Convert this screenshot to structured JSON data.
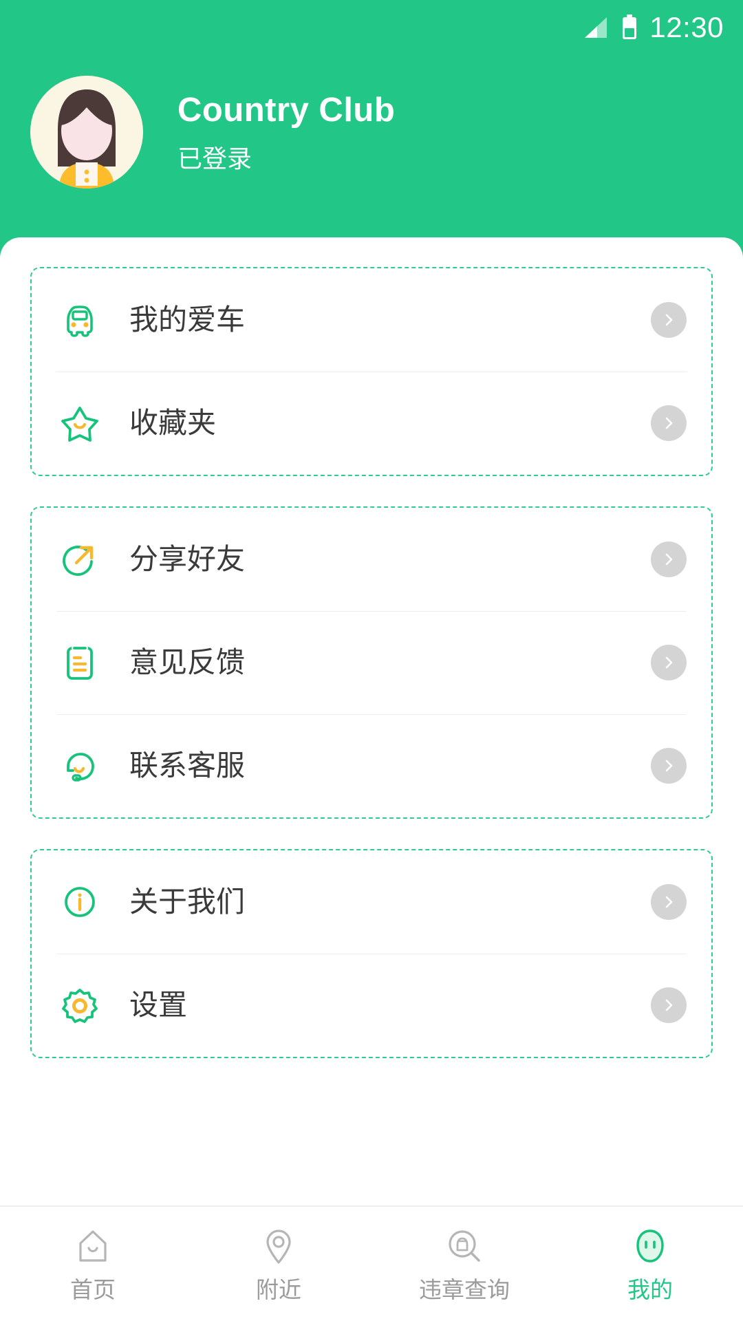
{
  "status_bar": {
    "time": "12:30",
    "signal_icon": "signal-bars-icon",
    "battery_icon": "battery-icon"
  },
  "header": {
    "avatar_icon": "user-avatar-female",
    "name": "Country Club",
    "login_status": "已登录",
    "background_color": "#22c686"
  },
  "colors": {
    "accent_green": "#22c686",
    "icon_green": "#2ecc8f",
    "icon_yellow": "#f5b82e",
    "text_dark": "#3a3a3a",
    "text_muted": "#9b9b9b",
    "chevron_bg": "#d4d4d4"
  },
  "groups": [
    {
      "id": "vehicle-group",
      "items": [
        {
          "id": "my-car",
          "label": "我的爱车",
          "icon": "car-icon",
          "chevron": "chevron-right-icon"
        },
        {
          "id": "favorites",
          "label": "收藏夹",
          "icon": "star-icon",
          "chevron": "chevron-right-icon"
        }
      ]
    },
    {
      "id": "social-group",
      "items": [
        {
          "id": "share-friends",
          "label": "分享好友",
          "icon": "share-arrow-icon",
          "chevron": "chevron-right-icon"
        },
        {
          "id": "feedback",
          "label": "意见反馈",
          "icon": "clipboard-icon",
          "chevron": "chevron-right-icon"
        },
        {
          "id": "contact-support",
          "label": "联系客服",
          "icon": "headset-icon",
          "chevron": "chevron-right-icon"
        }
      ]
    },
    {
      "id": "info-group",
      "items": [
        {
          "id": "about-us",
          "label": "关于我们",
          "icon": "info-circle-icon",
          "chevron": "chevron-right-icon"
        },
        {
          "id": "settings",
          "label": "设置",
          "icon": "gear-icon",
          "chevron": "chevron-right-icon"
        }
      ]
    }
  ],
  "tab_bar": {
    "tabs": [
      {
        "id": "home",
        "label": "首页",
        "icon": "house-icon",
        "active": false
      },
      {
        "id": "nearby",
        "label": "附近",
        "icon": "location-pin-icon",
        "active": false
      },
      {
        "id": "violation-query",
        "label": "违章查询",
        "icon": "car-search-icon",
        "active": false
      },
      {
        "id": "mine",
        "label": "我的",
        "icon": "face-icon",
        "active": true
      }
    ]
  }
}
